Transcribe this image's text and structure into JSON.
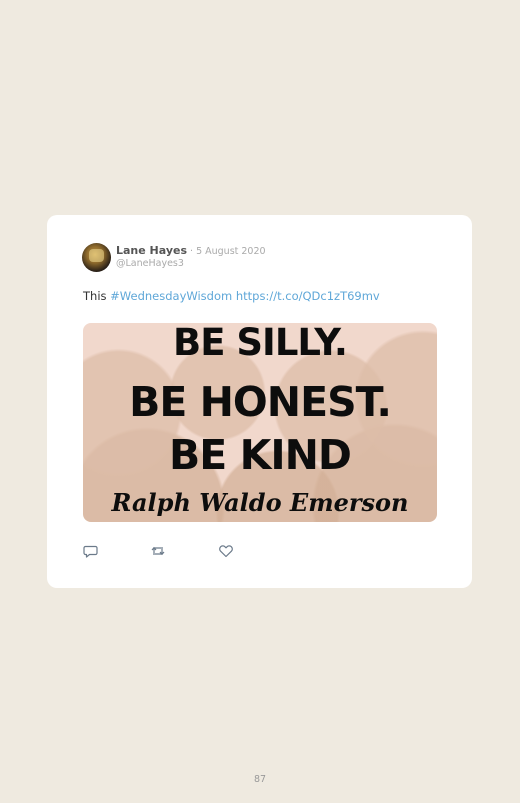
{
  "tweet": {
    "author_name": "Lane Hayes",
    "separator": "·",
    "date": "5 August 2020",
    "handle": "@LaneHayes3",
    "text_prefix": "This ",
    "hashtag": "#WednesdayWisdom",
    "url": "https://t.co/QDc1zT69mv",
    "media": {
      "quote_lines": [
        "BE SILLY.",
        "BE HONEST.",
        "BE KIND",
        "Ralph Waldo Emerson"
      ]
    },
    "actions": {
      "reply_icon": "reply-icon",
      "retweet_icon": "retweet-icon",
      "like_icon": "heart-icon"
    }
  },
  "page": {
    "number": "87"
  },
  "colors": {
    "background": "#efeae0",
    "card": "#ffffff",
    "link": "#5fa7d8",
    "muted": "#aaaaaa"
  }
}
